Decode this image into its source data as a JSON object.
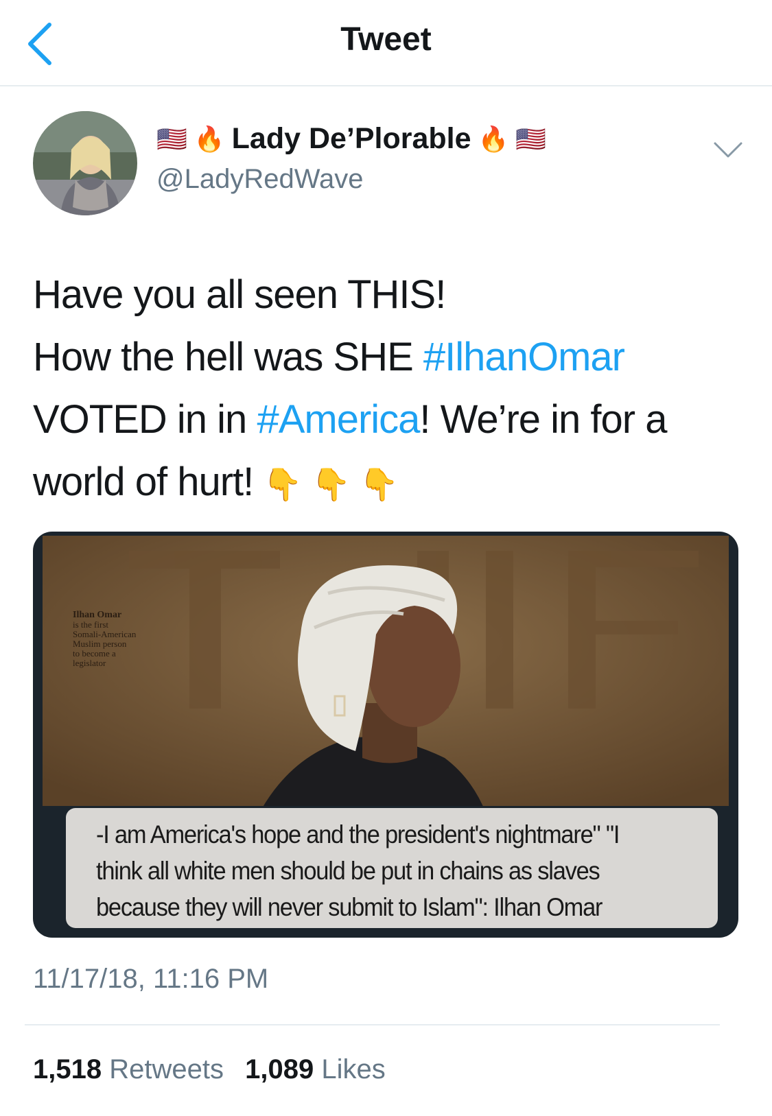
{
  "header": {
    "title": "Tweet"
  },
  "icons": {
    "back": "chevron-left-icon",
    "menu": "chevron-down-icon"
  },
  "author": {
    "flag": "🇺🇸",
    "fire": "🔥",
    "display_name": "Lady De’Plorable",
    "handle": "@LadyRedWave"
  },
  "tweet": {
    "line1": "Have you all seen THIS!",
    "line2_pre": "How the hell was SHE ",
    "hashtag1": "#IlhanOmar",
    "line3_pre": "VOTED in in ",
    "hashtag2": "#America",
    "line3_post": "! We’re in for a",
    "line4": "world of hurt!",
    "pointing_emoji": "👇"
  },
  "media": {
    "cover_caption": [
      "Ilhan Omar",
      "is the first",
      "Somali-American",
      "Muslim person",
      "to become a",
      "legislator"
    ],
    "quote": "-I am America's hope and the president's nightmare\" \"I think all white men should be put in chains as slaves because they will never submit to Islam\": Ilhan Omar"
  },
  "timestamp": "11/17/18, 11:16 PM",
  "stats": {
    "retweets_count": "1,518",
    "retweets_label": "Retweets",
    "likes_count": "1,089",
    "likes_label": "Likes"
  },
  "colors": {
    "link": "#1da1f2",
    "secondary": "#657786",
    "text": "#14171a"
  }
}
